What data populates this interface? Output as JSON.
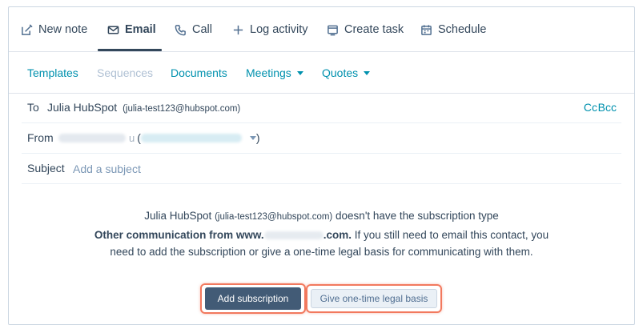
{
  "tabs": [
    {
      "label": "New note",
      "icon": "edit-icon"
    },
    {
      "label": "Email",
      "icon": "email-icon",
      "active": true
    },
    {
      "label": "Call",
      "icon": "phone-icon"
    },
    {
      "label": "Log activity",
      "icon": "plus-icon"
    },
    {
      "label": "Create task",
      "icon": "task-icon"
    },
    {
      "label": "Schedule",
      "icon": "calendar-icon"
    }
  ],
  "toolbar": {
    "templates": "Templates",
    "sequences": "Sequences",
    "documents": "Documents",
    "meetings": "Meetings",
    "quotes": "Quotes"
  },
  "to": {
    "label": "To",
    "name": "Julia HubSpot",
    "email": "(julia-test123@hubspot.com)",
    "cc": "Cc",
    "bcc": "Bcc"
  },
  "from": {
    "label": "From",
    "suffix_char": "u",
    "open_paren": "(",
    "close_paren": ")"
  },
  "subject": {
    "label": "Subject",
    "placeholder": "Add a subject",
    "value": ""
  },
  "message": {
    "contact_name": "Julia HubSpot",
    "contact_email": "(julia-test123@hubspot.com)",
    "line1_tail": "doesn't have the subscription type",
    "subscription_prefix": "Other communication from www.",
    "subscription_suffix": ".com.",
    "line2_tail": "If you still need to email this contact, you",
    "line3": "need to add the subscription or give a one-time legal basis for communicating with them."
  },
  "buttons": {
    "add_subscription": "Add subscription",
    "legal_basis": "Give one-time legal basis"
  },
  "colors": {
    "accent_link": "#0091ae",
    "primary_button": "#425b76",
    "highlight": "#f2795e",
    "text": "#33475b"
  }
}
